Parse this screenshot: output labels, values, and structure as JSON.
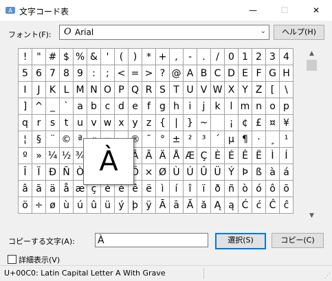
{
  "window": {
    "title": "文字コード表",
    "minimize_glyph": "—",
    "maximize_glyph": "☐",
    "close_glyph": "✕"
  },
  "font_row": {
    "label": "フォント(F):",
    "font_icon": "O",
    "font_name": "Arial",
    "help_button": "ヘルプ(H)"
  },
  "grid_rows": [
    [
      "!",
      "\"",
      "#",
      "$",
      "%",
      "&",
      "'",
      "(",
      ")",
      "*",
      "+",
      ",",
      "-",
      ".",
      "/",
      "0",
      "1",
      "2",
      "3",
      "4"
    ],
    [
      "5",
      "6",
      "7",
      "8",
      "9",
      ":",
      ";",
      "<",
      "=",
      ">",
      "?",
      "@",
      "A",
      "B",
      "C",
      "D",
      "E",
      "F",
      "G",
      "H"
    ],
    [
      "I",
      "J",
      "K",
      "L",
      "M",
      "N",
      "O",
      "P",
      "Q",
      "R",
      "S",
      "T",
      "U",
      "V",
      "W",
      "X",
      "Y",
      "Z",
      "[",
      "\\"
    ],
    [
      "]",
      "^",
      "_",
      "`",
      "a",
      "b",
      "c",
      "d",
      "e",
      "f",
      "g",
      "h",
      "i",
      "j",
      "k",
      "l",
      "m",
      "n",
      "o",
      "p"
    ],
    [
      "q",
      "r",
      "s",
      "t",
      "u",
      "v",
      "w",
      "x",
      "y",
      "z",
      "{",
      "|",
      "}",
      "~",
      " ",
      "¡",
      "¢",
      "£",
      "¤",
      "¥"
    ],
    [
      "¦",
      "§",
      "¨",
      "©",
      "ª",
      "«",
      "¬",
      "­",
      "®",
      "¯",
      "°",
      "±",
      "²",
      "³",
      "´",
      "µ",
      "¶",
      "·",
      "¸",
      "¹"
    ],
    [
      "º",
      "»",
      "¼",
      "½",
      "¾",
      "¿",
      "À",
      "Á",
      "Â",
      "Ã",
      "Ä",
      "Å",
      "Æ",
      "Ç",
      "È",
      "É",
      "Ê",
      "Ë",
      "Ì",
      "Í"
    ],
    [
      "Î",
      "Ï",
      "Ð",
      "Ñ",
      "Ò",
      "Ó",
      "Ô",
      "Õ",
      "Ö",
      "×",
      "Ø",
      "Ù",
      "Ú",
      "Û",
      "Ü",
      "Ý",
      "Þ",
      "ß",
      "à",
      "á"
    ],
    [
      "â",
      "ã",
      "ä",
      "å",
      "æ",
      "ç",
      "è",
      "é",
      "ê",
      "ë",
      "ì",
      "í",
      "î",
      "ï",
      "ð",
      "ñ",
      "ò",
      "ó",
      "ô",
      "õ"
    ],
    [
      "ö",
      "÷",
      "ø",
      "ù",
      "ú",
      "û",
      "ü",
      "ý",
      "þ",
      "ÿ",
      "Ā",
      "ā",
      "Ă",
      "ă",
      "Ą",
      "ą",
      "Ć",
      "ć",
      "Ĉ",
      "ĉ"
    ]
  ],
  "zoomed_char": "À",
  "scrollbar": {
    "up_arrow": "▲",
    "down_arrow": "▼"
  },
  "copy_row": {
    "label": "コピーする文字(A):",
    "value": "À",
    "select_button": "選択(S)",
    "copy_button": "コピー(C)"
  },
  "details": {
    "checked": false,
    "label": "詳細表示(V)"
  },
  "status": {
    "text": "U+00C0: Latin Capital Letter A With Grave",
    "grip": "⋰"
  },
  "colors": {
    "accent": "#0078d7"
  }
}
